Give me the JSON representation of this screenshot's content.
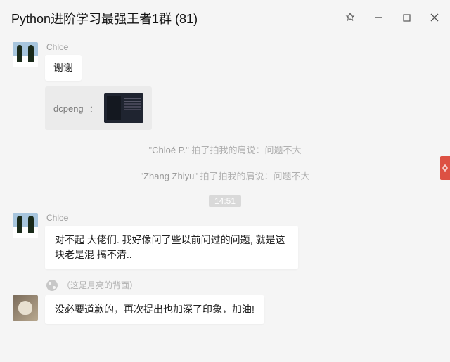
{
  "header": {
    "title": "Python进阶学习最强王者1群 (81)"
  },
  "messages": {
    "m1": {
      "sender": "Chloe",
      "text": "谢谢"
    },
    "m1_quote": {
      "author": "dcpeng",
      "colon": "："
    },
    "pat1": {
      "prefix": "\"",
      "name": "Chloé P.",
      "suffix": "\" 拍了拍我的肩说：问题不大"
    },
    "pat2": {
      "prefix": "\"",
      "name": "Zhang Zhiyu",
      "suffix": "\" 拍了拍我的肩说：问题不大"
    },
    "time1": "14:51",
    "m2": {
      "sender": "Chloe",
      "text": "对不起 大佬们. 我好像问了些以前问过的问题, 就是这块老是混 搞不清.."
    },
    "m3": {
      "badge": "（这是月亮的背面）",
      "text": "没必要道歉的，再次提出也加深了印象，加油!"
    }
  }
}
